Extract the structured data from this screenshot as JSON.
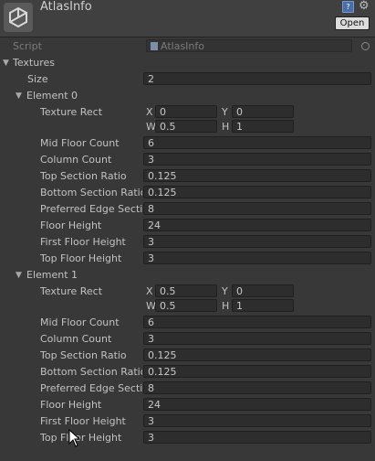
{
  "header": {
    "title": "AtlasInfo",
    "open_label": "Open",
    "help_glyph": "?",
    "gear_glyph": "⚙"
  },
  "script": {
    "label": "Script",
    "value": "AtlasInfo"
  },
  "textures": {
    "label": "Textures",
    "size_label": "Size",
    "size_value": "2",
    "elements": [
      {
        "label": "Element 0",
        "texture_rect": {
          "label": "Texture Rect",
          "x": "0",
          "y": "0",
          "w": "0.5",
          "h": "1"
        },
        "mid_floor_count": {
          "label": "Mid Floor Count",
          "value": "6"
        },
        "column_count": {
          "label": "Column Count",
          "value": "3"
        },
        "top_section_ratio": {
          "label": "Top Section Ratio",
          "value": "0.125"
        },
        "bottom_section_ratio": {
          "label": "Bottom Section Ratio",
          "value": "0.125"
        },
        "preferred_edge_section": {
          "label": "Preferred Edge Section",
          "value": "8"
        },
        "floor_height": {
          "label": "Floor Height",
          "value": "24"
        },
        "first_floor_height": {
          "label": "First Floor Height",
          "value": "3"
        },
        "top_floor_height": {
          "label": "Top Floor Height",
          "value": "3"
        }
      },
      {
        "label": "Element 1",
        "texture_rect": {
          "label": "Texture Rect",
          "x": "0.5",
          "y": "0",
          "w": "0.5",
          "h": "1"
        },
        "mid_floor_count": {
          "label": "Mid Floor Count",
          "value": "6"
        },
        "column_count": {
          "label": "Column Count",
          "value": "3"
        },
        "top_section_ratio": {
          "label": "Top Section Ratio",
          "value": "0.125"
        },
        "bottom_section_ratio": {
          "label": "Bottom Section Ratio",
          "value": "0.125"
        },
        "preferred_edge_section": {
          "label": "Preferred Edge Section",
          "value": "8"
        },
        "floor_height": {
          "label": "Floor Height",
          "value": "24"
        },
        "first_floor_height": {
          "label": "First Floor Height",
          "value": "3"
        },
        "top_floor_height": {
          "label": "Top Floor Height",
          "value": "3"
        }
      }
    ]
  },
  "rect_axis_labels": {
    "x": "X",
    "y": "Y",
    "w": "W",
    "h": "H"
  },
  "foldout_glyph": "▼"
}
